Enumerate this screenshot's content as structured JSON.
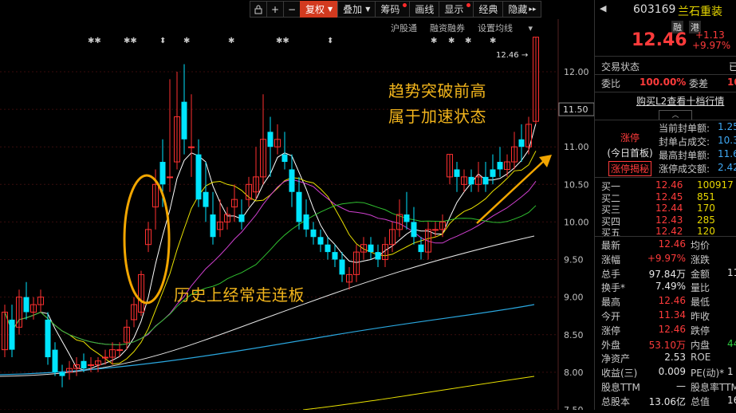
{
  "toolbar": {
    "items": [
      {
        "label": "复权",
        "active": true,
        "caret": true
      },
      {
        "label": "叠加",
        "caret": true
      },
      {
        "label": "筹码",
        "dot": true
      },
      {
        "label": "画线"
      },
      {
        "label": "显示",
        "dot": true
      },
      {
        "label": "经典"
      },
      {
        "label": "隐藏"
      }
    ],
    "lock_icon": "lock-icon",
    "plus": "+",
    "minus": "−",
    "more": "▸▸"
  },
  "subbar": {
    "items": [
      "沪股通",
      "融资融券",
      "设置均线"
    ]
  },
  "annotations": {
    "line1": "趋势突破前高",
    "line2": "属于加速状态",
    "history": "历史上经常走连板"
  },
  "chart_data": {
    "type": "candlestick",
    "yticks": [
      "12.00",
      "11.50",
      "11.00",
      "10.50",
      "10.00",
      "9.50",
      "9.00",
      "8.50",
      "8.00",
      "7.50"
    ],
    "ylim": [
      7.5,
      12.7
    ],
    "high_label": "12.46",
    "current_badge": "11.50",
    "candles": [
      [
        8.3,
        8.8,
        8.2,
        8.9
      ],
      [
        8.7,
        8.3,
        8.2,
        8.9
      ],
      [
        8.6,
        9.0,
        8.5,
        9.1
      ],
      [
        9.0,
        8.8,
        8.7,
        9.2
      ],
      [
        8.8,
        8.9,
        8.7,
        9.0
      ],
      [
        8.9,
        9.0,
        8.8,
        9.1
      ],
      [
        8.7,
        8.2,
        8.1,
        8.8
      ],
      [
        8.3,
        8.0,
        7.95,
        8.4
      ],
      [
        8.0,
        7.95,
        7.8,
        8.1
      ],
      [
        8.0,
        8.05,
        7.9,
        8.15
      ],
      [
        8.05,
        8.1,
        7.95,
        8.2
      ],
      [
        8.15,
        8.05,
        8.0,
        8.25
      ],
      [
        8.1,
        8.1,
        8.0,
        8.2
      ],
      [
        8.1,
        8.15,
        8.0,
        8.2
      ],
      [
        8.2,
        8.2,
        8.1,
        8.3
      ],
      [
        8.2,
        8.3,
        8.1,
        8.4
      ],
      [
        8.3,
        8.3,
        8.2,
        8.4
      ],
      [
        8.4,
        8.6,
        8.3,
        8.7
      ],
      [
        8.7,
        8.9,
        8.6,
        9.0
      ],
      [
        8.8,
        9.3,
        8.75,
        9.35
      ],
      [
        9.7,
        9.9,
        9.6,
        10.0
      ],
      [
        10.2,
        10.5,
        9.9,
        10.7
      ],
      [
        10.8,
        10.5,
        10.2,
        11.1
      ],
      [
        10.6,
        10.6,
        10.4,
        11.9
      ],
      [
        10.8,
        11.4,
        10.7,
        12.0
      ],
      [
        11.6,
        11.1,
        10.9,
        12.1
      ],
      [
        11.0,
        11.0,
        10.6,
        11.7
      ],
      [
        10.9,
        10.3,
        10.2,
        11.1
      ],
      [
        10.4,
        10.2,
        10.0,
        10.8
      ],
      [
        10.1,
        9.8,
        9.7,
        10.4
      ],
      [
        9.9,
        10.0,
        9.8,
        10.3
      ],
      [
        10.0,
        10.1,
        9.9,
        10.2
      ],
      [
        10.2,
        10.3,
        10.0,
        10.5
      ],
      [
        10.1,
        10.0,
        9.9,
        10.3
      ],
      [
        10.3,
        10.5,
        10.2,
        10.6
      ],
      [
        10.4,
        10.6,
        10.3,
        11.0
      ],
      [
        10.6,
        11.1,
        10.5,
        11.7
      ],
      [
        11.2,
        11.0,
        10.6,
        11.4
      ],
      [
        11.0,
        11.1,
        10.9,
        11.3
      ],
      [
        10.9,
        10.8,
        10.7,
        11.2
      ],
      [
        10.7,
        10.4,
        10.2,
        10.9
      ],
      [
        10.4,
        10.0,
        9.9,
        10.6
      ],
      [
        10.1,
        9.9,
        9.8,
        10.3
      ],
      [
        9.9,
        9.8,
        9.7,
        10.0
      ],
      [
        9.8,
        9.7,
        9.6,
        9.9
      ],
      [
        9.7,
        9.6,
        9.5,
        9.8
      ],
      [
        9.6,
        9.5,
        9.4,
        9.7
      ],
      [
        9.5,
        9.3,
        9.2,
        9.6
      ],
      [
        9.2,
        9.3,
        9.1,
        9.4
      ],
      [
        9.3,
        9.6,
        9.2,
        9.7
      ],
      [
        9.6,
        9.7,
        9.5,
        9.8
      ],
      [
        9.7,
        9.6,
        9.5,
        9.8
      ],
      [
        9.6,
        9.5,
        9.4,
        9.7
      ],
      [
        9.5,
        9.7,
        9.4,
        9.8
      ],
      [
        9.7,
        9.9,
        9.6,
        10.0
      ],
      [
        9.9,
        10.1,
        9.8,
        10.3
      ],
      [
        10.1,
        10.0,
        9.9,
        10.4
      ],
      [
        10.0,
        9.8,
        9.7,
        10.2
      ],
      [
        9.7,
        9.6,
        9.5,
        9.8
      ],
      [
        9.6,
        9.9,
        9.5,
        10.0
      ],
      [
        9.9,
        9.9,
        9.8,
        10.0
      ],
      [
        9.9,
        10.0,
        9.8,
        10.1
      ],
      [
        10.6,
        10.9,
        10.5,
        10.9
      ],
      [
        10.7,
        10.6,
        10.4,
        10.8
      ],
      [
        10.5,
        10.6,
        10.4,
        10.7
      ],
      [
        10.6,
        10.5,
        10.4,
        10.7
      ],
      [
        10.5,
        10.6,
        10.4,
        10.8
      ],
      [
        10.6,
        10.5,
        10.4,
        10.8
      ],
      [
        10.7,
        10.6,
        10.5,
        10.9
      ],
      [
        10.8,
        10.7,
        10.6,
        11.0
      ],
      [
        10.7,
        10.8,
        10.6,
        10.9
      ],
      [
        10.8,
        11.0,
        10.7,
        11.2
      ],
      [
        11.1,
        11.0,
        10.8,
        11.3
      ],
      [
        11.0,
        11.3,
        10.9,
        11.4
      ],
      [
        11.34,
        12.46,
        11.3,
        12.46
      ]
    ]
  },
  "panel": {
    "code": "603169",
    "name": "兰石重装",
    "tags": [
      "融",
      "港"
    ],
    "price": "12.46",
    "change": "+1.13",
    "change_pct": "+9.97%",
    "status_label": "交易状态",
    "status_val": "已",
    "weibi_label": "委比",
    "weibi_val": "100.00%",
    "weicha_label": "委差",
    "weicha_val": "10",
    "l2_link": "购买L2查看十档行情",
    "zt_title": "涨停",
    "zt_sub": "(今日首板)",
    "zt_btn": "涨停揭秘",
    "zt_items": [
      {
        "label": "当前封单额:",
        "val": "1.25"
      },
      {
        "label": "封单占成交:",
        "val": "10.3"
      },
      {
        "label": "最高封单额:",
        "val": "11.6"
      },
      {
        "label": "涨停成交额:",
        "val": "2.42"
      }
    ],
    "buys": [
      {
        "label": "买一",
        "price": "12.46",
        "vol": "100917"
      },
      {
        "label": "买二",
        "price": "12.45",
        "vol": "851"
      },
      {
        "label": "买三",
        "price": "12.44",
        "vol": "170"
      },
      {
        "label": "买四",
        "price": "12.43",
        "vol": "285"
      },
      {
        "label": "买五",
        "price": "12.42",
        "vol": "120"
      }
    ],
    "stats": [
      {
        "l": "最新",
        "v": "12.46",
        "c": "red",
        "r": "均价"
      },
      {
        "l": "涨幅",
        "v": "+9.97%",
        "c": "red",
        "r": "涨跌"
      },
      {
        "l": "总手",
        "v": "97.84万",
        "c": "white",
        "r": "金额",
        "rv": "11"
      },
      {
        "l": "换手*",
        "v": "7.49%",
        "c": "white",
        "r": "量比"
      },
      {
        "l": "最高",
        "v": "12.46",
        "c": "red",
        "r": "最低"
      },
      {
        "l": "今开",
        "v": "11.34",
        "c": "red",
        "r": "昨收"
      },
      {
        "l": "涨停",
        "v": "12.46",
        "c": "red",
        "r": "跌停"
      },
      {
        "l": "外盘",
        "v": "53.10万",
        "c": "red",
        "r": "内盘",
        "rv": "44",
        "rc": "green"
      },
      {
        "l": "净资产",
        "v": "2.53",
        "c": "white",
        "r": "ROE"
      },
      {
        "l": "收益(三)",
        "v": "0.009",
        "c": "white",
        "r": "PE(动)*",
        "rv": "1"
      },
      {
        "l": "股息TTM",
        "v": "—",
        "c": "white",
        "r": "股息率TTM"
      },
      {
        "l": "总股本",
        "v": "13.06亿",
        "c": "white",
        "r": "总值",
        "rv": "16"
      }
    ]
  }
}
